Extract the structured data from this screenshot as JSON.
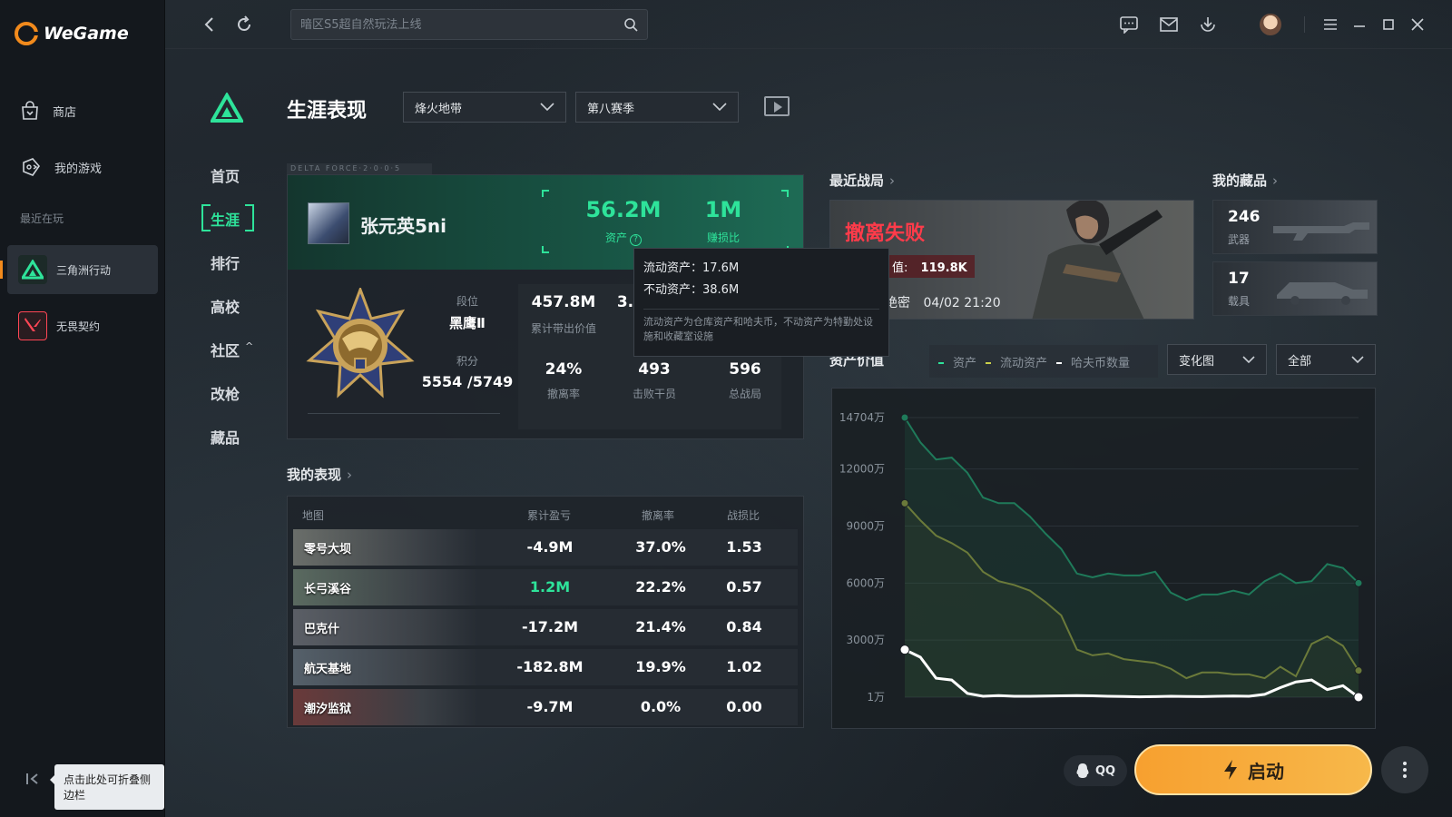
{
  "app": {
    "logo_text": "WeGame"
  },
  "sidebar": {
    "items": [
      {
        "label": "商店",
        "icon": "store-bag-icon"
      },
      {
        "label": "我的游戏",
        "icon": "gamepad-icon"
      }
    ],
    "recent_label": "最近在玩",
    "games": [
      {
        "label": "三角洲行动",
        "icon": "delta-force-icon",
        "active": true
      },
      {
        "label": "无畏契约",
        "icon": "valorant-icon",
        "active": false
      }
    ],
    "collapse_tip": "点击此处可折叠侧边栏"
  },
  "topbar": {
    "search_placeholder": "暗区S5超自然玩法上线"
  },
  "header": {
    "title": "生涯表现",
    "mode_select": "烽火地带",
    "season_select": "第八赛季"
  },
  "subnav": [
    {
      "label": "首页",
      "active": false
    },
    {
      "label": "生涯",
      "active": true
    },
    {
      "label": "排行",
      "active": false
    },
    {
      "label": "高校",
      "active": false
    },
    {
      "label": "社区",
      "active": false,
      "caret": "^"
    },
    {
      "label": "改枪",
      "active": false
    },
    {
      "label": "藏品",
      "active": false
    }
  ],
  "profile": {
    "strip_text": "DELTA FORCE·2·0·0·5",
    "player_name": "张元英5ni",
    "assets_value": "56.2M",
    "assets_label": "资产",
    "ratio_value": "1M",
    "ratio_label": "赚损比",
    "rank_label": "段位",
    "rank_value": "黑鹰Ⅱ",
    "score_label": "积分",
    "score_value": "5554 /5749",
    "stats": [
      {
        "value": "457.8M",
        "label": "累计带出价值"
      },
      {
        "value": "3.",
        "label": ""
      },
      {
        "value": "24%",
        "label": "撤离率"
      },
      {
        "value": "493",
        "label": "击败干员"
      },
      {
        "value": "596",
        "label": "总战局"
      }
    ]
  },
  "tooltip": {
    "liquid": "流动资产：17.6M",
    "fixed": "不动资产：38.6M",
    "note": "流动资产为仓库资产和哈夫币，不动资产为特勤处设施和收藏室设施"
  },
  "performance": {
    "title": "我的表现",
    "columns": [
      "地图",
      "累计盈亏",
      "撤离率",
      "战损比"
    ],
    "rows": [
      {
        "map": "零号大坝",
        "pnl": "-4.9M",
        "pnl_color": "#ffffff",
        "rate": "37.0%",
        "kd": "1.53"
      },
      {
        "map": "长弓溪谷",
        "pnl": "1.2M",
        "pnl_color": "#2ee39a",
        "rate": "22.2%",
        "kd": "0.57"
      },
      {
        "map": "巴克什",
        "pnl": "-17.2M",
        "pnl_color": "#ffffff",
        "rate": "21.4%",
        "kd": "0.84"
      },
      {
        "map": "航天基地",
        "pnl": "-182.8M",
        "pnl_color": "#ffffff",
        "rate": "19.9%",
        "kd": "1.02"
      },
      {
        "map": "潮汐监狱",
        "pnl": "-9.7M",
        "pnl_color": "#ffffff",
        "rate": "0.0%",
        "kd": "0.00"
      }
    ]
  },
  "recent": {
    "title": "最近战局",
    "result": "撤离失败",
    "value_label": "值:",
    "value": "119.8K",
    "mode": "绝密",
    "time": "04/02 21:20"
  },
  "collection": {
    "title": "我的藏品",
    "items": [
      {
        "value": "246",
        "label": "武器"
      },
      {
        "value": "17",
        "label": "载具"
      }
    ]
  },
  "assets_chart": {
    "title": "资产价值",
    "legend": [
      "资产",
      "流动资产",
      "哈夫币数量"
    ],
    "view_select": "变化图",
    "range_select": "全部"
  },
  "colors": {
    "accent_green": "#2ee39a",
    "accent_orange": "#f7a02f",
    "danger_red": "#ff3b4a"
  },
  "chart_data": {
    "type": "line",
    "title": "",
    "xlabel": "",
    "ylabel": "",
    "yticks": [
      "1万",
      "3000万",
      "6000万",
      "9000万",
      "12000万",
      "14704万"
    ],
    "ylim": [
      0,
      14704
    ],
    "x": [
      1,
      2,
      3,
      4,
      5,
      6,
      7,
      8,
      9,
      10,
      11,
      12,
      13,
      14,
      15,
      16,
      17,
      18,
      19,
      20,
      21,
      22,
      23,
      24,
      25,
      26,
      27,
      28,
      29,
      30
    ],
    "series": [
      {
        "name": "资产",
        "color": "#1f7a5a",
        "values": [
          14704,
          13400,
          12500,
          12600,
          11800,
          10500,
          10200,
          10200,
          9500,
          8600,
          7800,
          6500,
          6300,
          6500,
          6400,
          6400,
          6600,
          5500,
          5100,
          5400,
          5400,
          5600,
          5400,
          6100,
          6500,
          6000,
          6100,
          7000,
          6800,
          6000
        ]
      },
      {
        "name": "流动资产",
        "color": "#6b7a3a",
        "values": [
          10200,
          9300,
          8500,
          8100,
          7600,
          6600,
          6100,
          5900,
          5600,
          5000,
          4300,
          2500,
          2200,
          2300,
          2000,
          1900,
          1800,
          1500,
          1000,
          1300,
          1300,
          1200,
          1200,
          1000,
          1600,
          1100,
          2800,
          3200,
          2700,
          1400
        ]
      },
      {
        "name": "哈夫币数量",
        "color": "#ffffff",
        "values": [
          2500,
          2100,
          1000,
          900,
          200,
          50,
          80,
          50,
          50,
          60,
          70,
          80,
          70,
          50,
          40,
          20,
          30,
          50,
          40,
          30,
          50,
          60,
          50,
          150,
          500,
          800,
          900,
          400,
          600,
          1
        ]
      }
    ]
  }
}
